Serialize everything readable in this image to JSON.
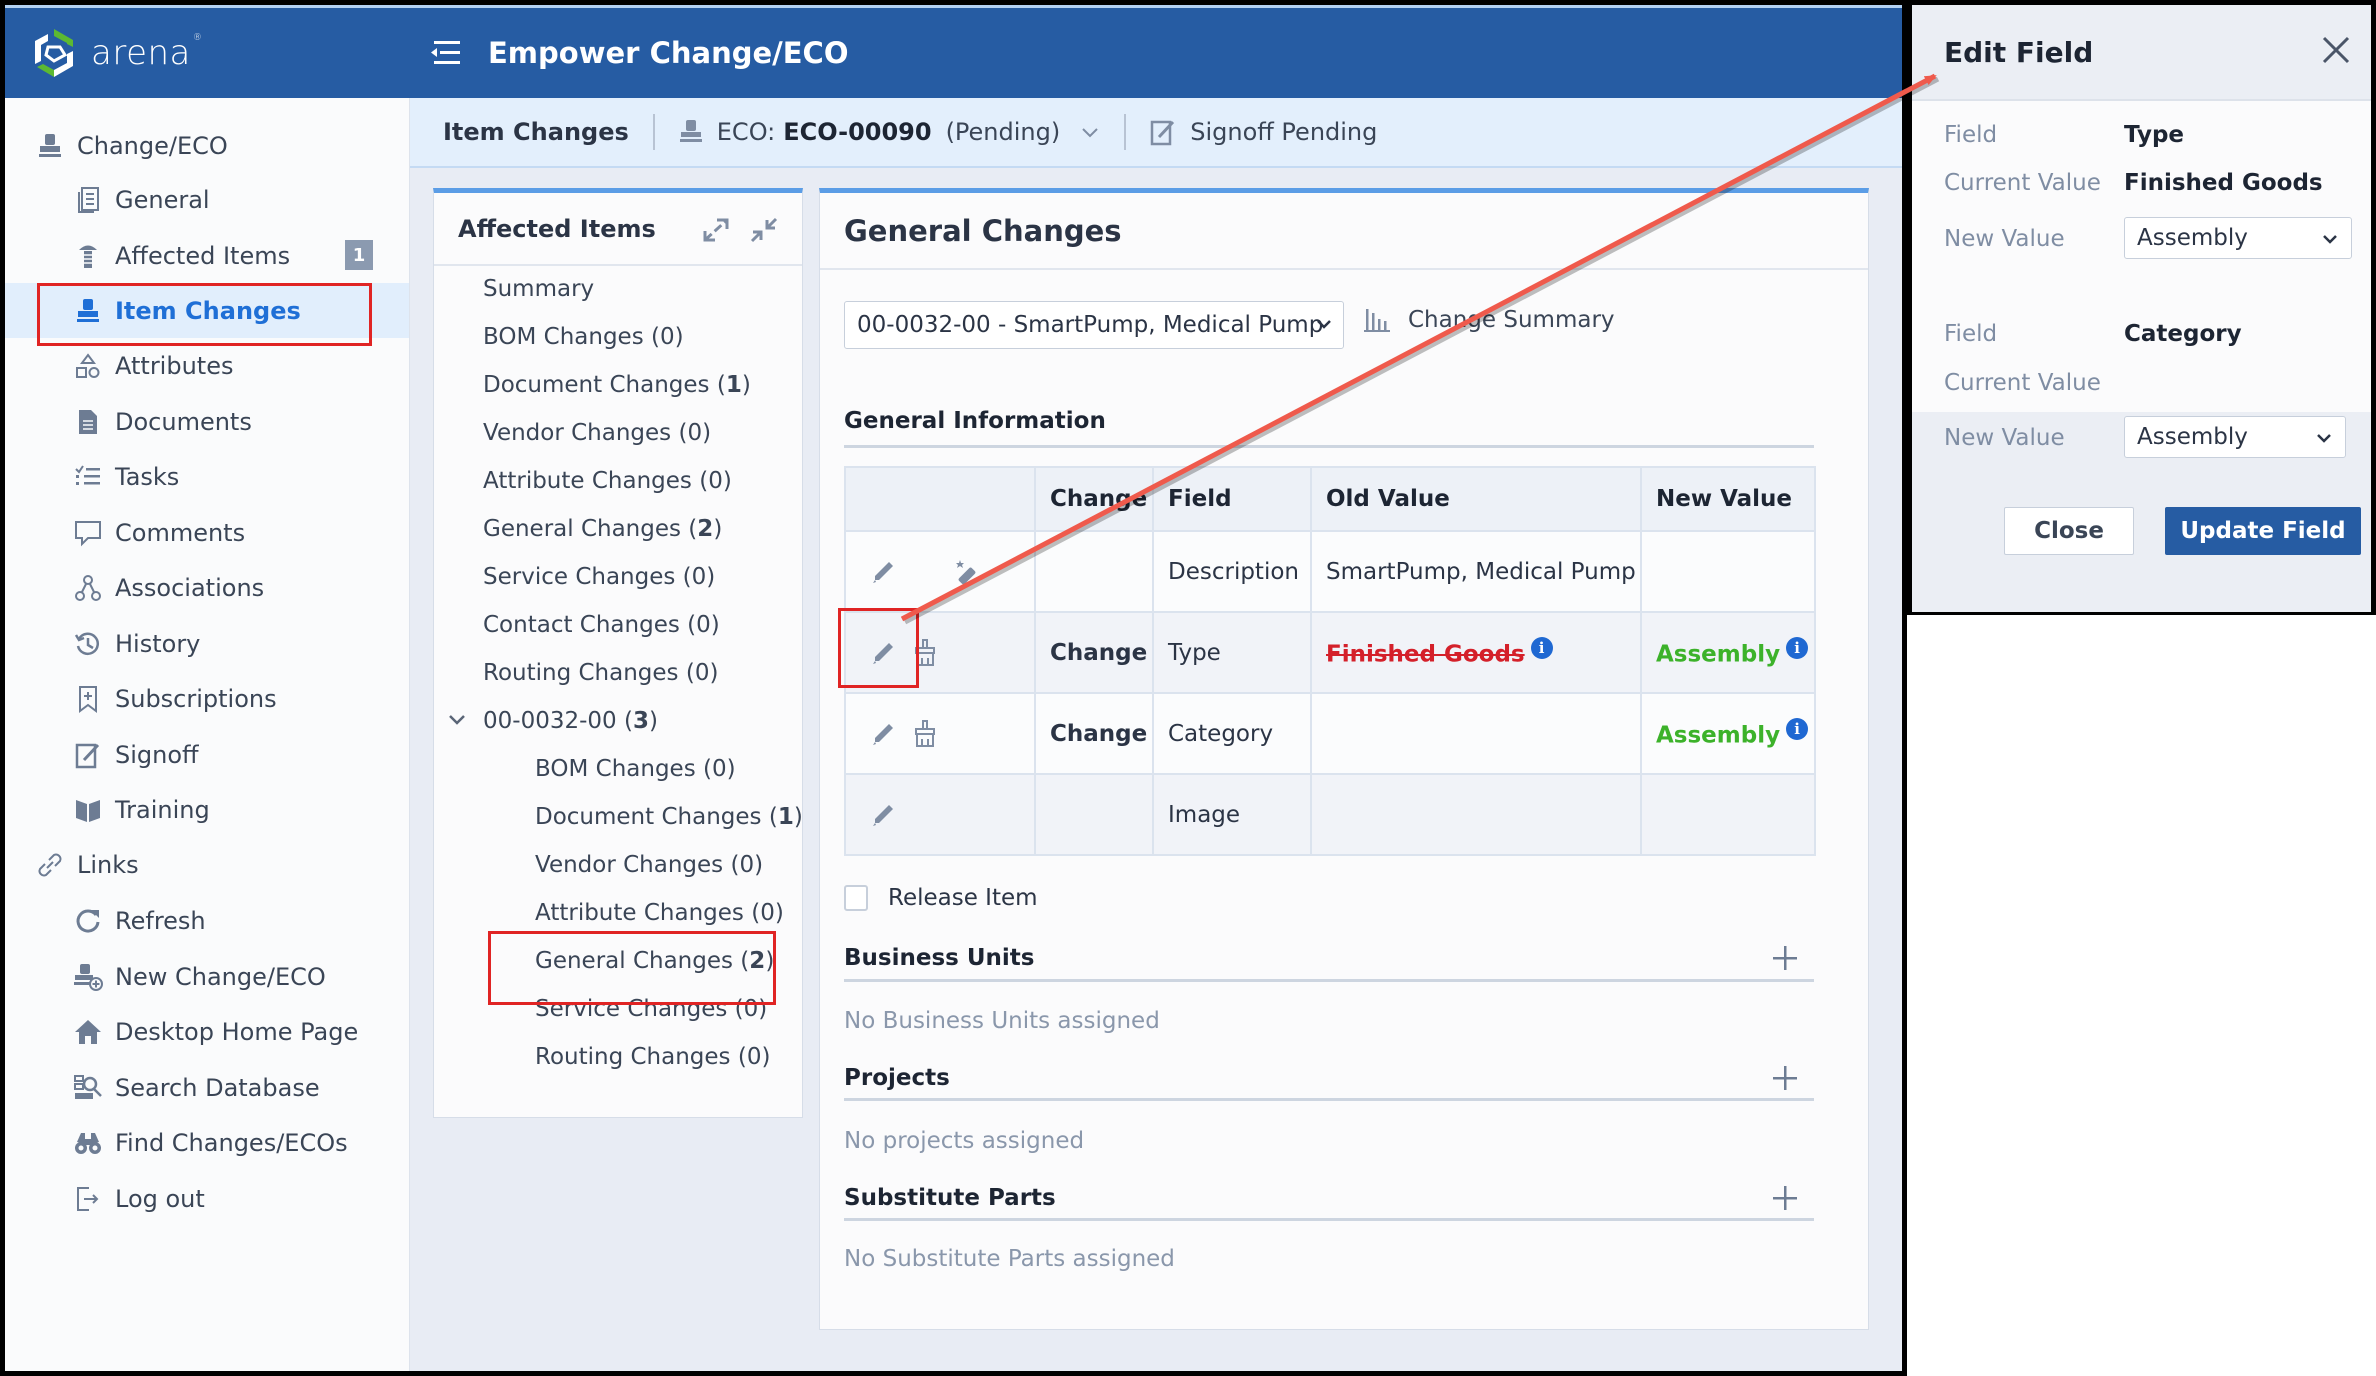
{
  "brand": {
    "logo_text": "arena"
  },
  "header": {
    "title": "Empower Change/ECO"
  },
  "sidebar": {
    "items": [
      {
        "label": "Change/ECO",
        "icon": "stamp-icon",
        "level": 0
      },
      {
        "label": "General",
        "icon": "document-list-icon",
        "level": 1
      },
      {
        "label": "Affected Items",
        "icon": "screw-icon",
        "level": 1,
        "badge": "1"
      },
      {
        "label": "Item Changes",
        "icon": "stamp-icon",
        "level": 1,
        "active": true
      },
      {
        "label": "Attributes",
        "icon": "shapes-icon",
        "level": 1
      },
      {
        "label": "Documents",
        "icon": "file-icon",
        "level": 1
      },
      {
        "label": "Tasks",
        "icon": "checklist-icon",
        "level": 1
      },
      {
        "label": "Comments",
        "icon": "comment-icon",
        "level": 1
      },
      {
        "label": "Associations",
        "icon": "nodes-icon",
        "level": 1
      },
      {
        "label": "History",
        "icon": "history-icon",
        "level": 1
      },
      {
        "label": "Subscriptions",
        "icon": "bookmark-plus-icon",
        "level": 1
      },
      {
        "label": "Signoff",
        "icon": "signoff-icon",
        "level": 1
      },
      {
        "label": "Training",
        "icon": "book-icon",
        "level": 1
      },
      {
        "label": "Links",
        "icon": "link-icon",
        "level": 0
      },
      {
        "label": "Refresh",
        "icon": "refresh-icon",
        "level": 1
      },
      {
        "label": "New Change/ECO",
        "icon": "stamp-plus-icon",
        "level": 1
      },
      {
        "label": "Desktop Home Page",
        "icon": "home-icon",
        "level": 1
      },
      {
        "label": "Search Database",
        "icon": "search-database-icon",
        "level": 1
      },
      {
        "label": "Find Changes/ECOs",
        "icon": "binoculars-icon",
        "level": 1
      },
      {
        "label": "Log out",
        "icon": "logout-icon",
        "level": 1
      }
    ]
  },
  "subheader": {
    "title": "Item Changes",
    "eco_prefix": "ECO:",
    "eco_number": "ECO-00090",
    "eco_status": "(Pending)",
    "signoff_label": "Signoff Pending"
  },
  "affected_items": {
    "title": "Affected Items",
    "items": [
      {
        "label": "Summary",
        "count": "",
        "level": 0
      },
      {
        "label": "BOM Changes",
        "count": "0",
        "level": 0
      },
      {
        "label": "Document Changes",
        "count": "1",
        "level": 0
      },
      {
        "label": "Vendor Changes",
        "count": "0",
        "level": 0
      },
      {
        "label": "Attribute Changes",
        "count": "0",
        "level": 0
      },
      {
        "label": "General Changes",
        "count": "2",
        "level": 0
      },
      {
        "label": "Service Changes",
        "count": "0",
        "level": 0
      },
      {
        "label": "Contact Changes",
        "count": "0",
        "level": 0
      },
      {
        "label": "Routing Changes",
        "count": "0",
        "level": 0
      },
      {
        "label": "00-0032-00",
        "count": "3",
        "level": 0,
        "expandable": true
      },
      {
        "label": "BOM Changes",
        "count": "0",
        "level": 1
      },
      {
        "label": "Document Changes",
        "count": "1",
        "level": 1
      },
      {
        "label": "Vendor Changes",
        "count": "0",
        "level": 1
      },
      {
        "label": "Attribute Changes",
        "count": "0",
        "level": 1
      },
      {
        "label": "General Changes",
        "count": "2",
        "level": 1,
        "highlighted": true
      },
      {
        "label": "Service Changes",
        "count": "0",
        "level": 1
      },
      {
        "label": "Routing Changes",
        "count": "0",
        "level": 1
      }
    ]
  },
  "general_changes": {
    "title": "General Changes",
    "part_select_value": "00-0032-00 - SmartPump, Medical Pump",
    "change_summary_label": "Change Summary",
    "general_info_title": "General Information",
    "table": {
      "columns": [
        "",
        "Change",
        "Field",
        "Old Value",
        "New Value"
      ],
      "rows": [
        {
          "change": "",
          "field": "Description",
          "old_value": "SmartPump, Medical Pump",
          "new_value": "",
          "second_icon": "magic-wand-icon"
        },
        {
          "change": "Change",
          "field": "Type",
          "old_value": "Finished Goods",
          "new_value": "Assembly",
          "second_icon": "broom-icon",
          "old_struck": true
        },
        {
          "change": "Change",
          "field": "Category",
          "old_value": "",
          "new_value": "Assembly",
          "second_icon": "broom-icon"
        },
        {
          "change": "",
          "field": "Image",
          "old_value": "",
          "new_value": "",
          "second_icon": ""
        }
      ]
    },
    "release_item_label": "Release Item",
    "release_item_checked": false,
    "business_units": {
      "title": "Business Units",
      "empty": "No Business Units assigned"
    },
    "projects": {
      "title": "Projects",
      "empty": "No projects assigned"
    },
    "substitute_parts": {
      "title": "Substitute Parts",
      "empty": "No Substitute Parts assigned"
    }
  },
  "edit_field": {
    "title": "Edit Field",
    "blocks": [
      {
        "field_label": "Field",
        "field_value": "Type",
        "current_label": "Current Value",
        "current_value": "Finished Goods",
        "new_label": "New Value",
        "new_value": "Assembly"
      },
      {
        "field_label": "Field",
        "field_value": "Category",
        "current_label": "Current Value",
        "current_value": "",
        "new_label": "New Value",
        "new_value": "Assembly"
      }
    ],
    "close_label": "Close",
    "update_label": "Update Field"
  },
  "colors": {
    "brand_blue": "#265ca3",
    "accent_blue": "#1f6fd6",
    "old_value_red": "#d4202a",
    "new_value_green": "#3cb22a",
    "annotation_red": "#e02424"
  }
}
